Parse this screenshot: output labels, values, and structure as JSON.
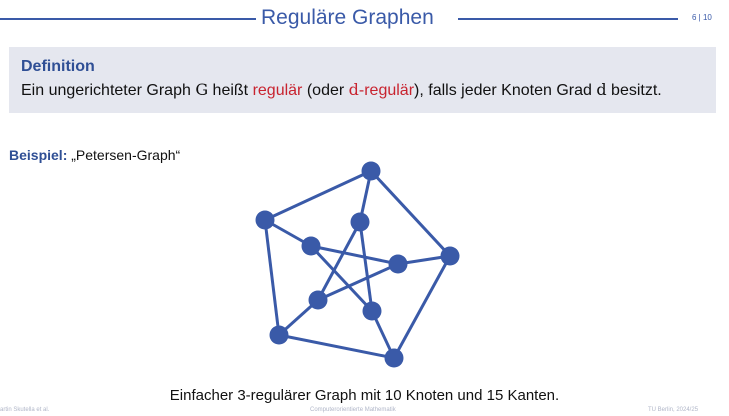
{
  "header": {
    "title": "Reguläre Graphen",
    "page": "6 | 10"
  },
  "definition": {
    "title": "Definition",
    "text_part1": "Ein ungerichteter Graph ",
    "symbol_graph": "G",
    "text_part2": " heißt ",
    "regular_word": "regulär",
    "text_part3": " (oder ",
    "symbol_d1": "d",
    "d_regular_suffix": "-regulär",
    "text_part4": "), falls jeder Knoten Grad ",
    "symbol_d2": "d",
    "text_part5": " besitzt."
  },
  "example": {
    "label": "Beispiel:",
    "text": "„Petersen-Graph“"
  },
  "graph": {
    "node_color": "#3a5aa8",
    "edge_color": "#3a5aa8",
    "nodes": 10,
    "edges": 15
  },
  "caption": "Einfacher 3-regulärer Graph mit 10 Knoten und 15 Kanten.",
  "footer": {
    "left": "artin Skutella et al.",
    "center": "Computerorientierte Mathematik",
    "right": "TU Berlin, 2024/25"
  }
}
